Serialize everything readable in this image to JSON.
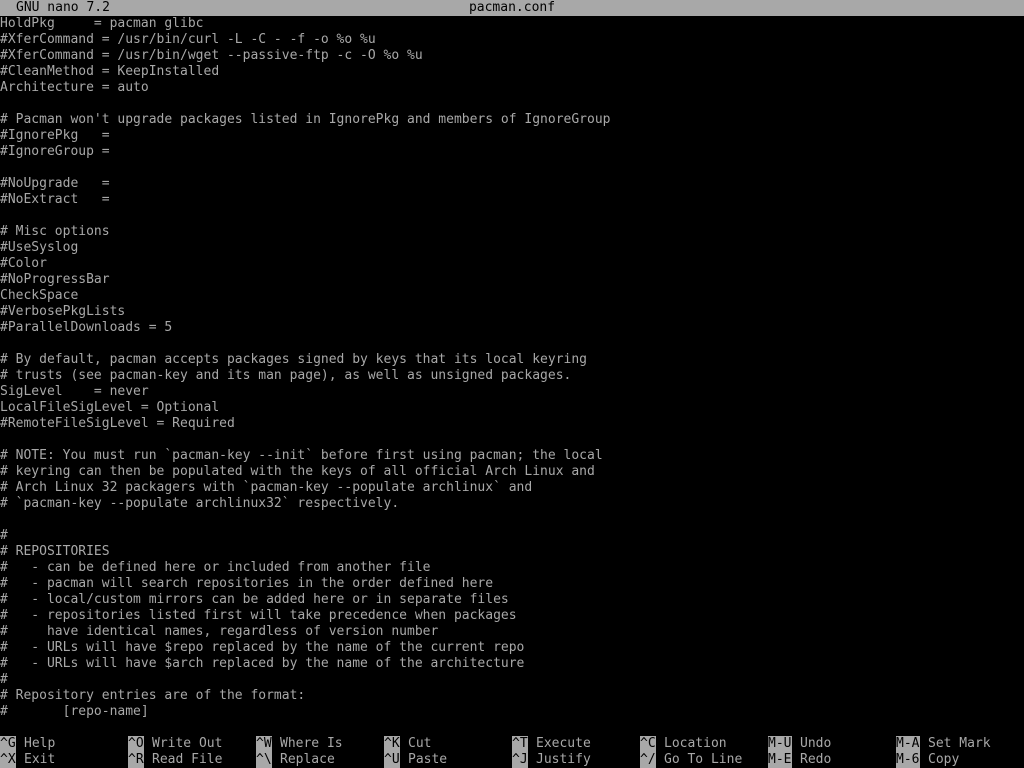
{
  "titlebar": {
    "app": "GNU nano 7.2",
    "file": "pacman.conf"
  },
  "editor": {
    "lines": [
      "HoldPkg     = pacman glibc",
      "#XferCommand = /usr/bin/curl -L -C - -f -o %o %u",
      "#XferCommand = /usr/bin/wget --passive-ftp -c -O %o %u",
      "#CleanMethod = KeepInstalled",
      "Architecture = auto",
      "",
      "# Pacman won't upgrade packages listed in IgnorePkg and members of IgnoreGroup",
      "#IgnorePkg   =",
      "#IgnoreGroup =",
      "",
      "#NoUpgrade   =",
      "#NoExtract   =",
      "",
      "# Misc options",
      "#UseSyslog",
      "#Color",
      "#NoProgressBar",
      "CheckSpace",
      "#VerbosePkgLists",
      "#ParallelDownloads = 5",
      "",
      "# By default, pacman accepts packages signed by keys that its local keyring",
      "# trusts (see pacman-key and its man page), as well as unsigned packages.",
      "SigLevel    = never",
      "LocalFileSigLevel = Optional",
      "#RemoteFileSigLevel = Required",
      "",
      "# NOTE: You must run `pacman-key --init` before first using pacman; the local",
      "# keyring can then be populated with the keys of all official Arch Linux and",
      "# Arch Linux 32 packagers with `pacman-key --populate archlinux` and",
      "# `pacman-key --populate archlinux32` respectively.",
      "",
      "#",
      "# REPOSITORIES",
      "#   - can be defined here or included from another file",
      "#   - pacman will search repositories in the order defined here",
      "#   - local/custom mirrors can be added here or in separate files",
      "#   - repositories listed first will take precedence when packages",
      "#     have identical names, regardless of version number",
      "#   - URLs will have $repo replaced by the name of the current repo",
      "#   - URLs will have $arch replaced by the name of the architecture",
      "#",
      "# Repository entries are of the format:",
      "#       [repo-name]"
    ]
  },
  "shortcuts": {
    "row1": [
      {
        "key": "^G",
        "label": "Help"
      },
      {
        "key": "^O",
        "label": "Write Out"
      },
      {
        "key": "^W",
        "label": "Where Is"
      },
      {
        "key": "^K",
        "label": "Cut"
      },
      {
        "key": "^T",
        "label": "Execute"
      },
      {
        "key": "^C",
        "label": "Location"
      },
      {
        "key": "M-U",
        "label": "Undo"
      },
      {
        "key": "M-A",
        "label": "Set Mark"
      }
    ],
    "row2": [
      {
        "key": "^X",
        "label": "Exit"
      },
      {
        "key": "^R",
        "label": "Read File"
      },
      {
        "key": "^\\",
        "label": "Replace"
      },
      {
        "key": "^U",
        "label": "Paste"
      },
      {
        "key": "^J",
        "label": "Justify"
      },
      {
        "key": "^/",
        "label": "Go To Line"
      },
      {
        "key": "M-E",
        "label": "Redo"
      },
      {
        "key": "M-6",
        "label": "Copy"
      }
    ]
  },
  "colors": {
    "background": "#000000",
    "foreground": "#a8a8a8",
    "inverse_bg": "#a8a8a8",
    "inverse_fg": "#000000"
  }
}
